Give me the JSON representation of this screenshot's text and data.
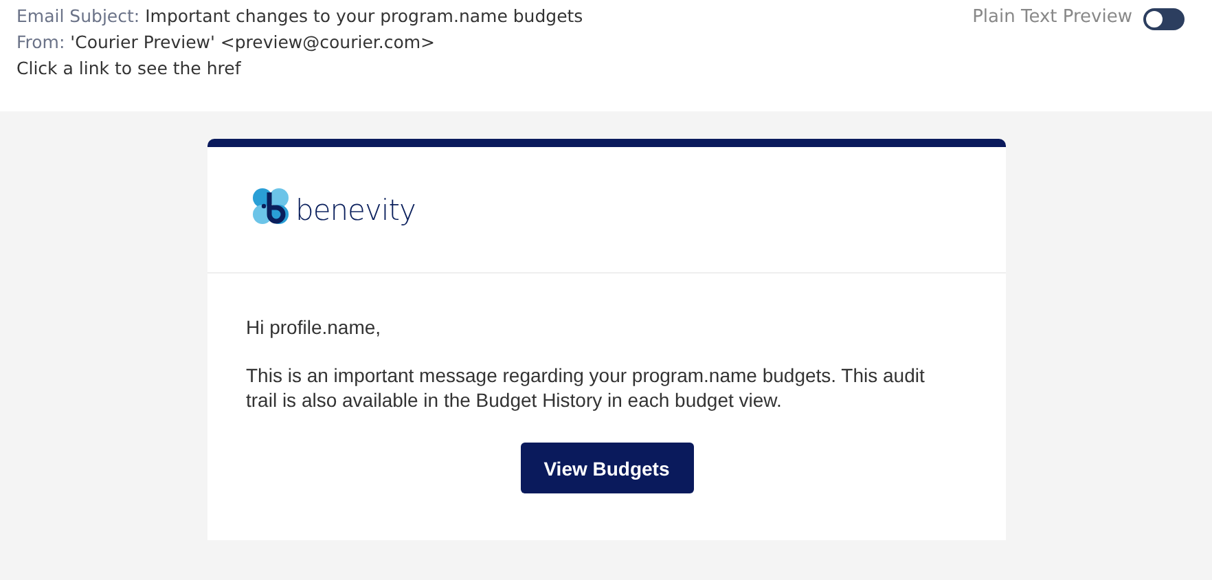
{
  "header": {
    "subject_label": "Email Subject:",
    "subject": "Important changes to your program.name budgets",
    "from_label": "From:",
    "from": "'Courier Preview' <preview@courier.com>",
    "hint": "Click a link to see the href"
  },
  "plain_text_preview": {
    "label": "Plain Text Preview",
    "on": false
  },
  "email": {
    "logo_text": "benevity",
    "greeting": "Hi profile.name,",
    "message": "This is an important message regarding your program.name budgets.  This audit trail is also available in the Budget History in each budget view.",
    "button": "View Budgets"
  }
}
